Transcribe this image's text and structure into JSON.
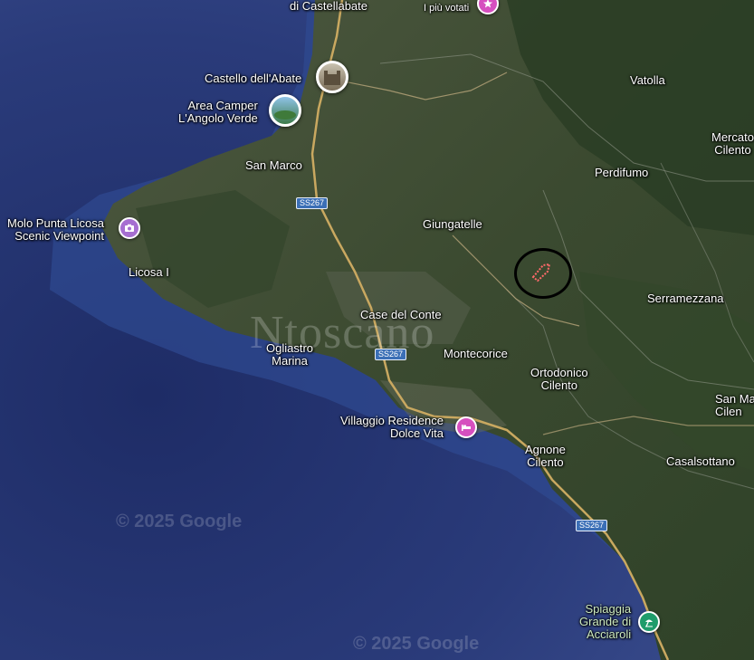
{
  "map": {
    "places": {
      "castellabate": "di Castellabate",
      "piu_votati": "I più votati",
      "castello": "Castello dell'Abate",
      "camper_1": "Area Camper",
      "camper_2": "L'Angolo Verde",
      "vatolla": "Vatolla",
      "mercato_1": "Mercato",
      "mercato_2": "Cilento",
      "san_marco": "San Marco",
      "perdifumo": "Perdifumo",
      "molo_1": "Molo Punta Licosa",
      "molo_2": "Scenic Viewpoint",
      "giungatelle": "Giungatelle",
      "licosa": "Licosa I",
      "serramezzana": "Serramezzana",
      "case_conte": "Case del Conte",
      "ogliastro_1": "Ogliastro",
      "ogliastro_2": "Marina",
      "montecorice": "Montecorice",
      "ortodonico_1": "Ortodonico",
      "ortodonico_2": "Cilento",
      "san_ma_1": "San Ma",
      "san_ma_2": "Cilen",
      "villaggio_1": "Villaggio Residence",
      "villaggio_2": "Dolce Vita",
      "agnone_1": "Agnone",
      "agnone_2": "Cilento",
      "casalsottano": "Casalsottano",
      "spiaggia_1": "Spiaggia",
      "spiaggia_2": "Grande di",
      "spiaggia_3": "Acciaroli"
    },
    "road_shield": "SS267",
    "watermark_google": "© 2025 Google",
    "watermark_site": "Ntoscano",
    "colors": {
      "sea": "#24346e",
      "land": "#3c4a33",
      "road": "#c9a860",
      "parcel": "#ff6a6a",
      "pink_pin": "#d64fbf",
      "purple_pin": "#a66ed1",
      "green_pin": "#1f9c6b"
    },
    "icons": {
      "castle_pin": "castle-photo-icon",
      "camper_pin": "camper-photo-icon",
      "viewpoint_pin": "camera-icon",
      "hotel_pin": "bed-icon",
      "beach_pin": "beach-icon",
      "top_pin": "star-icon"
    }
  }
}
